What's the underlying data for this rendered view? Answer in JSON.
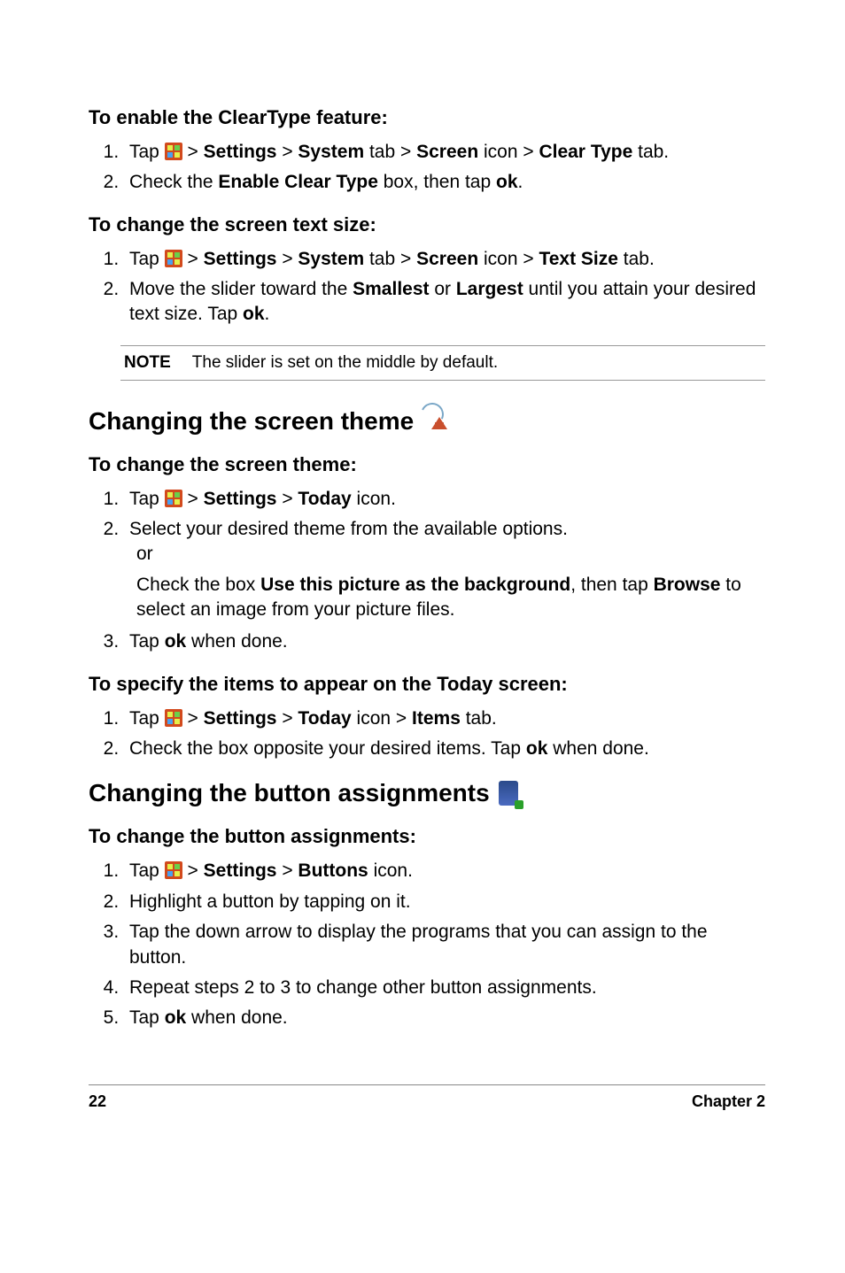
{
  "sec1": {
    "heading": "To enable the ClearType feature:",
    "step1": {
      "t1": "Tap ",
      "t2": " > ",
      "b1": "Settings",
      "t3": " > ",
      "b2": "System",
      "t4": " tab > ",
      "b3": "Screen",
      "t5": " icon > ",
      "b4": "Clear Type",
      "t6": " tab."
    },
    "step2": {
      "t1": "Check the ",
      "b1": "Enable Clear Type",
      "t2": " box, then tap ",
      "b2": "ok",
      "t3": "."
    }
  },
  "sec2": {
    "heading": "To change the screen text size:",
    "step1": {
      "t1": "Tap ",
      "t2": " > ",
      "b1": "Settings",
      "t3": " >  ",
      "b2": "System",
      "t4": " tab > ",
      "b3": "Screen",
      "t5": " icon > ",
      "b4": "Text Size",
      "t6": " tab."
    },
    "step2": {
      "t1": "Move the slider toward the ",
      "b1": "Smallest",
      "t2": " or ",
      "b2": "Largest",
      "t3": " until you attain your desired text size. Tap ",
      "b3": "ok",
      "t4": "."
    }
  },
  "note": {
    "label": "NOTE",
    "text": "The slider is set on the middle by default."
  },
  "sec3": {
    "title": "Changing the screen theme",
    "sub1": {
      "heading": "To change the screen theme:",
      "step1": {
        "t1": "Tap ",
        "t2": " > ",
        "b1": "Settings",
        "t3": " > ",
        "b2": "Today",
        "t4": " icon."
      },
      "step2": "Select your desired theme from the available options.",
      "or": "or",
      "detail": {
        "t1": "Check the box ",
        "b1": "Use this picture as the background",
        "t2": ", then tap ",
        "b2": "Browse",
        "t3": " to select an image from your picture files."
      },
      "step3": {
        "t1": "Tap ",
        "b1": "ok",
        "t2": " when done."
      }
    },
    "sub2": {
      "heading": "To specify the items to appear on the Today screen:",
      "step1": {
        "t1": "Tap ",
        "t2": " > ",
        "b1": "Settings",
        "t3": " >  ",
        "b2": "Today",
        "t4": " icon > ",
        "b3": "Items",
        "t5": " tab."
      },
      "step2": {
        "t1": "Check the box opposite your desired items. Tap ",
        "b1": "ok",
        "t2": " when done."
      }
    }
  },
  "sec4": {
    "title": "Changing the button assignments",
    "heading": "To change the button assignments:",
    "step1": {
      "t1": "Tap ",
      "t2": " > ",
      "b1": "Settings",
      "t3": " > ",
      "b2": "Buttons",
      "t4": " icon."
    },
    "step2": "Highlight a button by tapping on it.",
    "step3": "Tap the down arrow to display the programs that you can assign to the button.",
    "step4": "Repeat steps 2 to 3 to change other button assignments.",
    "step5": {
      "t1": "Tap ",
      "b1": "ok",
      "t2": " when done."
    }
  },
  "footer": {
    "page": "22",
    "chapter": "Chapter 2"
  }
}
